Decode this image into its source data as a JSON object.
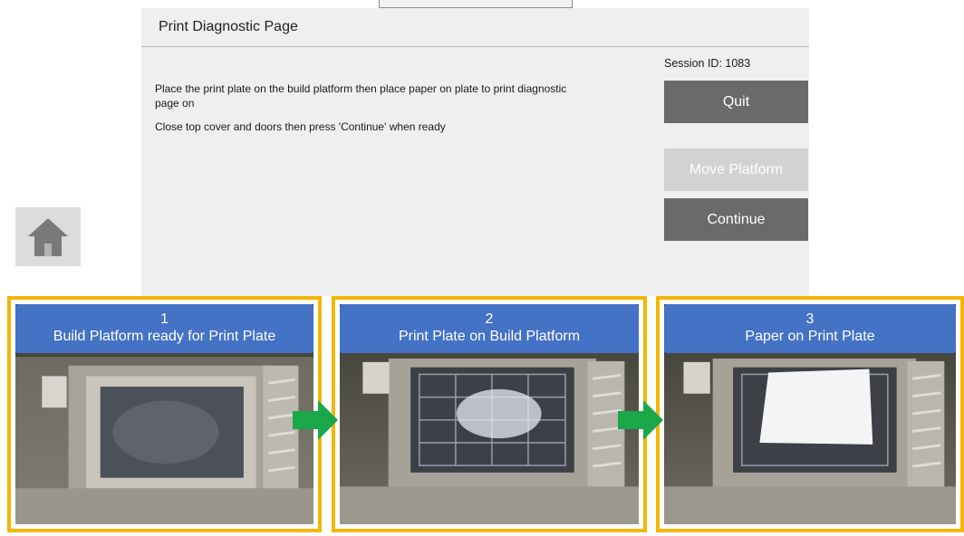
{
  "dialog": {
    "title": "Print Diagnostic Page",
    "session_id": "Session ID: 1083",
    "instruction_1": "Place the print plate on the build platform then place paper on plate to print diagnostic page on",
    "instruction_2": "Close top cover and doors then press 'Continue' when ready",
    "buttons": {
      "quit": "Quit",
      "move_platform": "Move Platform",
      "continue": "Continue"
    }
  },
  "home": {
    "icon": "home-icon"
  },
  "steps": [
    {
      "number": "1",
      "label": "Build Platform ready for Print Plate"
    },
    {
      "number": "2",
      "label": "Print Plate on Build Platform"
    },
    {
      "number": "3",
      "label": "Paper on Print Plate"
    }
  ],
  "colors": {
    "card_border": "#f2b705",
    "banner": "#4472c4",
    "arrow": "#1aa84a",
    "button_active": "#6a6a6a",
    "button_disabled": "#d2d2d2",
    "panel": "#efefef"
  }
}
